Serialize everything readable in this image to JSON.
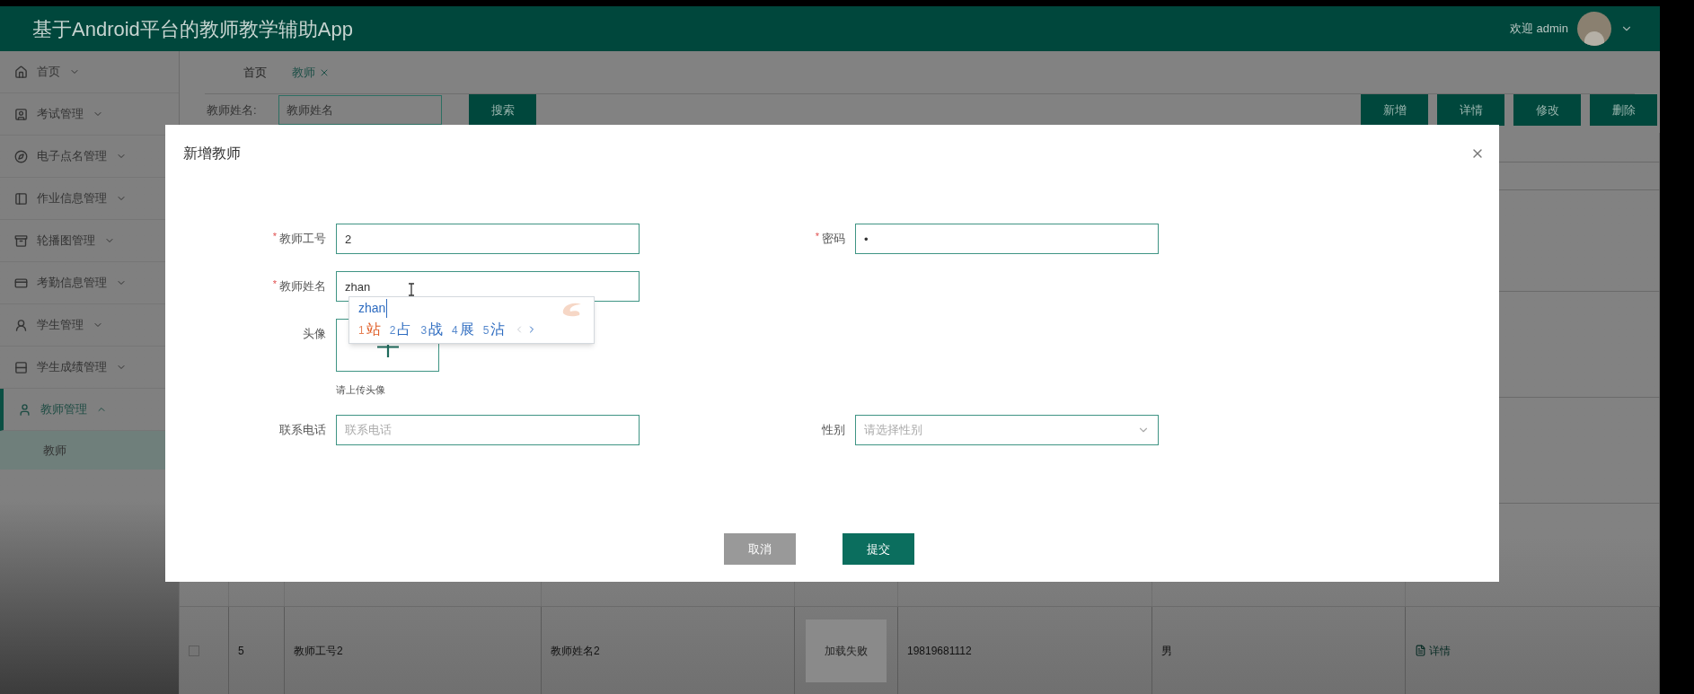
{
  "header": {
    "title": "基于Android平台的教师教学辅助App",
    "greeting": "欢迎 admin"
  },
  "sidebar": {
    "items": [
      {
        "label": "首页",
        "selected": false,
        "expanded": false
      },
      {
        "label": "考试管理",
        "selected": false,
        "expanded": false
      },
      {
        "label": "电子点名管理",
        "selected": false,
        "expanded": false
      },
      {
        "label": "作业信息管理",
        "selected": false,
        "expanded": false
      },
      {
        "label": "轮播图管理",
        "selected": false,
        "expanded": false
      },
      {
        "label": "考勤信息管理",
        "selected": false,
        "expanded": false
      },
      {
        "label": "学生管理",
        "selected": false,
        "expanded": false
      },
      {
        "label": "学生成绩管理",
        "selected": false,
        "expanded": false
      },
      {
        "label": "教师管理",
        "selected": true,
        "expanded": true,
        "children": [
          {
            "label": "教师",
            "selected": true
          }
        ]
      }
    ]
  },
  "tabs": [
    {
      "label": "首页",
      "selected": false,
      "closable": false
    },
    {
      "label": "教师",
      "selected": true,
      "closable": true
    }
  ],
  "search": {
    "label": "教师姓名:",
    "placeholder": "教师姓名",
    "button": "搜索"
  },
  "actions": [
    "新增",
    "详情",
    "修改",
    "删除"
  ],
  "table": {
    "rows": [
      {
        "checked": false,
        "index": "5",
        "teacher_id": "教师工号2",
        "teacher_name": "教师姓名2",
        "avatar": "加载失败",
        "phone": "19819681112",
        "gender": "男",
        "action": "详情"
      }
    ]
  },
  "dialog": {
    "title": "新增教师",
    "rows": [
      [
        {
          "kind": "text",
          "label": "教师工号",
          "required_mark": "*",
          "value": "2"
        },
        {
          "kind": "text",
          "label": "密码",
          "required_mark": "*",
          "value": "•"
        }
      ],
      [
        {
          "kind": "text",
          "label": "教师姓名",
          "required_mark": "*",
          "value": "zhan"
        }
      ],
      [
        {
          "kind": "upload",
          "label": "头像",
          "hint": "请上传头像"
        }
      ],
      [
        {
          "kind": "text",
          "label": "联系电话",
          "placeholder": "联系电话"
        },
        {
          "kind": "select",
          "label": "性别",
          "placeholder": "请选择性别"
        }
      ]
    ],
    "buttons": [
      {
        "label": "取消",
        "kind": "secondary"
      },
      {
        "label": "提交",
        "kind": "primary"
      }
    ],
    "ime": {
      "composition": "zhan",
      "candidates": [
        {
          "number": "1",
          "char": "站",
          "selected": true
        },
        {
          "number": "2",
          "char": "占",
          "selected": false
        },
        {
          "number": "3",
          "char": "战",
          "selected": false
        },
        {
          "number": "4",
          "char": "展",
          "selected": false
        },
        {
          "number": "5",
          "char": "沾",
          "selected": false
        }
      ]
    }
  }
}
